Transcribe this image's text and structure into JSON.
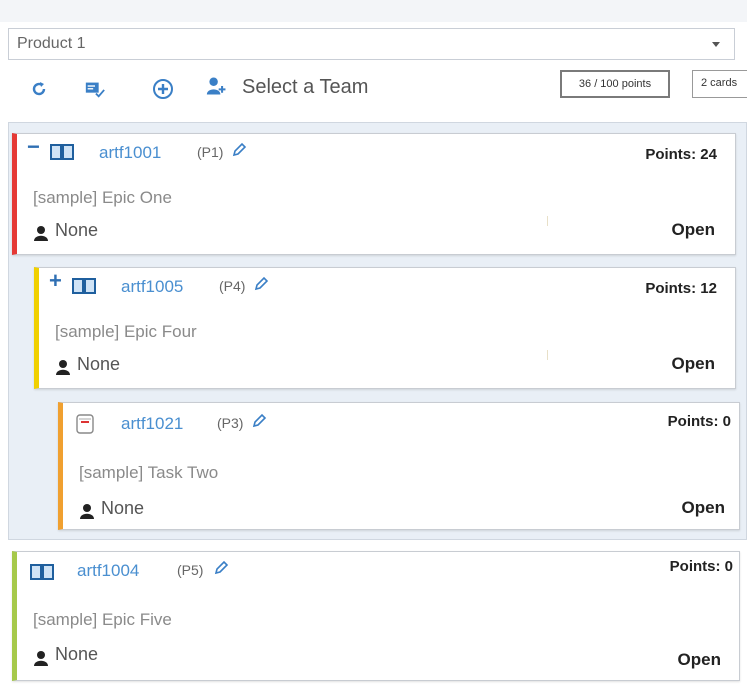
{
  "product_select": {
    "value": "Product 1"
  },
  "toolbar": {
    "icons": [
      "refresh-icon",
      "edit-check-icon",
      "add-circle-icon",
      "team-icon"
    ],
    "team_label": "Select a Team",
    "points_summary": "36 / 100 points",
    "cards_summary": "2 cards"
  },
  "colors": {
    "accent": "#3a7fc6",
    "card1_bar": "#e53935",
    "card2_bar": "#f0d000",
    "card3_bar": "#f0a030",
    "card4_bar": "#a6c94a"
  },
  "cards": [
    {
      "toggle": "−",
      "id": "artf1001",
      "priority": "(P1)",
      "points": "Points:  24",
      "title": "[sample] Epic One",
      "owner": "None",
      "status": "Open",
      "type_icon": "epic-book-icon"
    },
    {
      "toggle": "+",
      "id": "artf1005",
      "priority": "(P4)",
      "points": "Points:  12",
      "title": "[sample] Epic Four",
      "owner": "None",
      "status": "Open",
      "type_icon": "epic-book-icon"
    },
    {
      "toggle": "",
      "id": "artf1021",
      "priority": "(P3)",
      "points": "Points:  0",
      "title": "[sample] Task Two",
      "owner": "None",
      "status": "Open",
      "type_icon": "task-icon"
    },
    {
      "toggle": "",
      "id": "artf1004",
      "priority": "(P5)",
      "points": "Points:  0",
      "title": "[sample] Epic Five",
      "owner": "None",
      "status": "Open",
      "type_icon": "epic-book-icon"
    }
  ]
}
